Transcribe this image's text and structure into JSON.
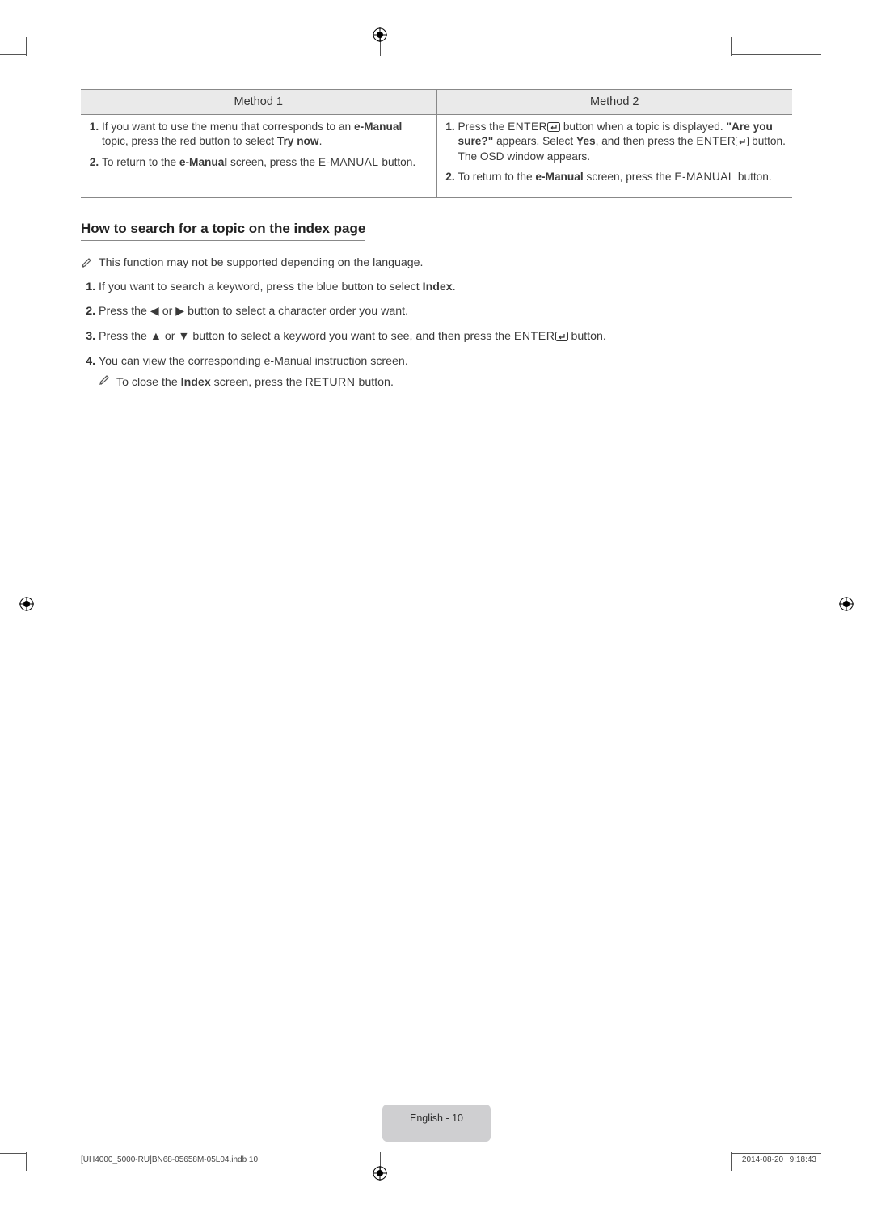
{
  "table": {
    "headers": [
      "Method 1",
      "Method 2"
    ],
    "method1": {
      "item1_a": "If you want to use the menu that corresponds to an ",
      "item1_b": "e-Manual",
      "item1_c": " topic, press the red button to select ",
      "item1_d": "Try now",
      "item1_e": ".",
      "item2_a": "To return to the ",
      "item2_b": "e-Manual",
      "item2_c": " screen, press the ",
      "item2_d": "E-MANUAL",
      "item2_e": " button."
    },
    "method2": {
      "item1_a": "Press the ",
      "item1_b": "ENTER",
      "item1_c": " button when a topic is displayed. ",
      "item1_d": "\"Are you sure?\"",
      "item1_e": " appears. Select ",
      "item1_f": "Yes",
      "item1_g": ", and then press the ",
      "item1_h": "ENTER",
      "item1_i": " button. The OSD window appears.",
      "item2_a": "To return to the ",
      "item2_b": "e-Manual",
      "item2_c": " screen, press the ",
      "item2_d": "E-MANUAL",
      "item2_e": " button."
    }
  },
  "section_title": "How to search for a topic on the index page",
  "note1": "This function may not be supported depending on the language.",
  "steps": {
    "s1_a": "If you want to search a keyword, press the blue button to select ",
    "s1_b": "Index",
    "s1_c": ".",
    "s2_a": "Press the ",
    "s2_b": " or ",
    "s2_c": " button to select a character order you want.",
    "s3_a": "Press the ",
    "s3_b": " or ",
    "s3_c": " button to select a keyword you want to see, and then press the ",
    "s3_d": "ENTER",
    "s3_e": " button.",
    "s4": "You can view the corresponding e-Manual instruction screen.",
    "s4_note_a": "To close the ",
    "s4_note_b": "Index",
    "s4_note_c": " screen, press the ",
    "s4_note_d": "RETURN",
    "s4_note_e": " button."
  },
  "footer": {
    "page_label": "English - 10",
    "meta_left": "[UH4000_5000-RU]BN68-05658M-05L04.indb   10",
    "meta_right": "2014-08-20     9:18:43"
  }
}
